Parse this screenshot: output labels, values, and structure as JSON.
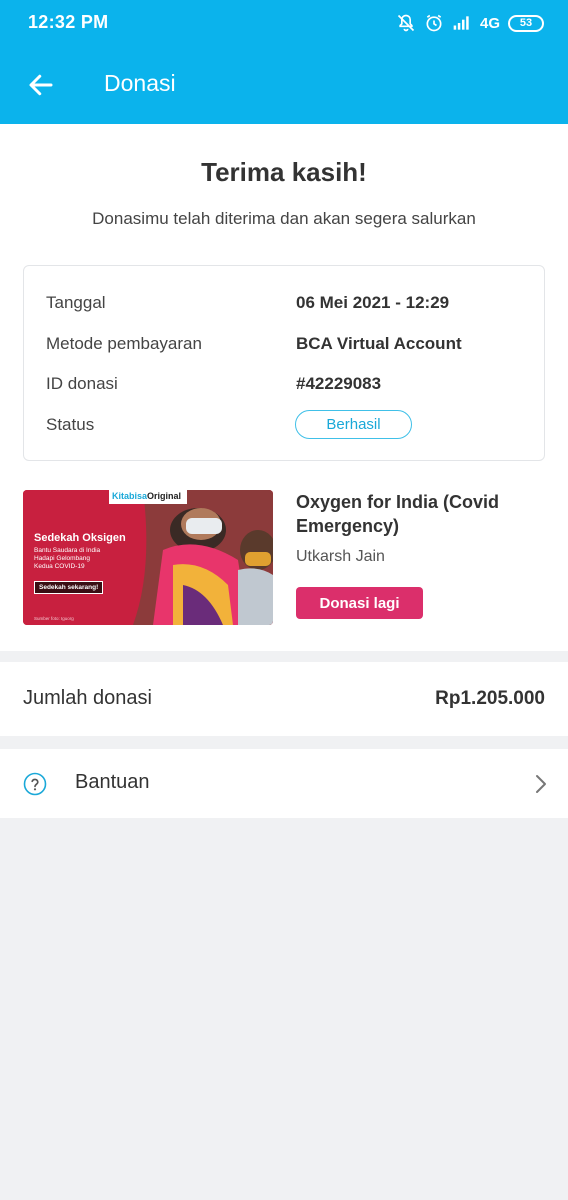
{
  "status_bar": {
    "time": "12:32 PM",
    "network": "4G",
    "battery": "53",
    "icons": [
      "notifications-off-icon",
      "alarm-icon",
      "signal-icon",
      "battery-icon"
    ]
  },
  "appbar": {
    "title": "Donasi",
    "back_icon": "arrow-left-icon"
  },
  "confirmation": {
    "heading": "Terima kasih!",
    "subtitle": "Donasimu telah diterima dan akan segera salurkan"
  },
  "details": {
    "rows": [
      {
        "label": "Tanggal",
        "value": "06 Mei 2021 - 12:29"
      },
      {
        "label": "Metode pembayaran",
        "value": "BCA Virtual Account"
      },
      {
        "label": "ID donasi",
        "value": "#42229083"
      },
      {
        "label": "Status",
        "value": "Berhasil"
      }
    ]
  },
  "campaign": {
    "image": {
      "brand_prefix": "Kitabisa",
      "brand_suffix": "Original",
      "headline": "Sedekah Oksigen",
      "line1": "Bantu Saudara di India",
      "line2": "Hadapi Gelombang",
      "line3": "Kedua COVID-19",
      "cta": "Sedekah sekarang!",
      "credit": "Sumber foto: Iguorg"
    },
    "title": "Oxygen for India (Covid Emergency)",
    "author": "Utkarsh Jain",
    "button_label": "Donasi lagi"
  },
  "amount": {
    "label": "Jumlah donasi",
    "value": "Rp1.205.000"
  },
  "help": {
    "label": "Bantuan",
    "icon": "help-circle-icon",
    "chevron": "chevron-right-icon"
  },
  "colors": {
    "primary": "#0bb3ec",
    "accent": "#db2f6b",
    "status": "#1aa8d8",
    "background": "#f0f1f3"
  }
}
